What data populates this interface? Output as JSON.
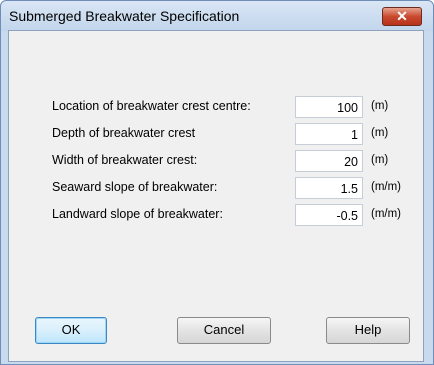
{
  "window": {
    "title": "Submerged Breakwater Specification",
    "close_glyph": "✕"
  },
  "fields": [
    {
      "label": "Location of breakwater crest centre:",
      "value": "100",
      "unit": "(m)"
    },
    {
      "label": "Depth of breakwater crest",
      "value": "1",
      "unit": "(m)"
    },
    {
      "label": "Width of breakwater crest:",
      "value": "20",
      "unit": "(m)"
    },
    {
      "label": "Seaward slope of breakwater:",
      "value": "1.5",
      "unit": "(m/m)"
    },
    {
      "label": "Landward slope of breakwater:",
      "value": "-0.5",
      "unit": "(m/m)"
    }
  ],
  "buttons": {
    "ok": "OK",
    "cancel": "Cancel",
    "help": "Help"
  }
}
